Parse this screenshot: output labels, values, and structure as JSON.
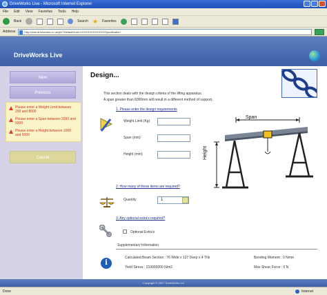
{
  "window": {
    "title": "DriveWorks Live - Microsoft Internet Explorer"
  },
  "menu": [
    "File",
    "Edit",
    "View",
    "Favorites",
    "Tools",
    "Help"
  ],
  "toolbar": {
    "back": "Back",
    "search": "Search",
    "favorites": "Favorites"
  },
  "address": {
    "label": "Address",
    "url": "http://dms.driveworks.co.uk/ph/?DefaultGuid=XXXXXXXXXXXXX/Specification",
    "go": "Go"
  },
  "app": {
    "title": "DriveWorks Live"
  },
  "sidebar": {
    "next": "Next",
    "previous": "Previous",
    "errors": [
      "Please enter a Weight Limit between 200 and 8000",
      "Please enter a Span between 2000 and 6000",
      "Please enter a Height between 1000 and 5000"
    ],
    "cancel": "Cancel"
  },
  "main": {
    "title": "Design...",
    "intro1": "This section deals with the design criteria of the lifting apparatus.",
    "intro2": "A span greater than 6000mm will result in a different method of support.",
    "section1": "1. Please enter the design requirements",
    "weight_label": "Weight Limit (Kg)",
    "span_label": "Span (mm)",
    "height_label": "Height (mm)",
    "section2": "2. How many of these items are required?",
    "qty_label": "Quantity",
    "qty_value": "1",
    "section3": "3. Any optional extra's required?",
    "optional_label": "Optional Extra's",
    "supp_heading": "Supplementary Information",
    "supp_left1": "Calculated Beam Section :  76 Wide x 127 Deep x 4 Thk",
    "supp_left2": "Yield Stress :  210000000 N/m2",
    "supp_right1": "Bending Moment :  0 Nmm",
    "supp_right2": "Max Shear Force :  0 N",
    "span_dim": "Span",
    "height_dim": "Height"
  },
  "footer": {
    "copyright": "Copyright © 2007 DriveWorks Ltd"
  },
  "status": {
    "left": "Done",
    "zone": "Internet"
  }
}
